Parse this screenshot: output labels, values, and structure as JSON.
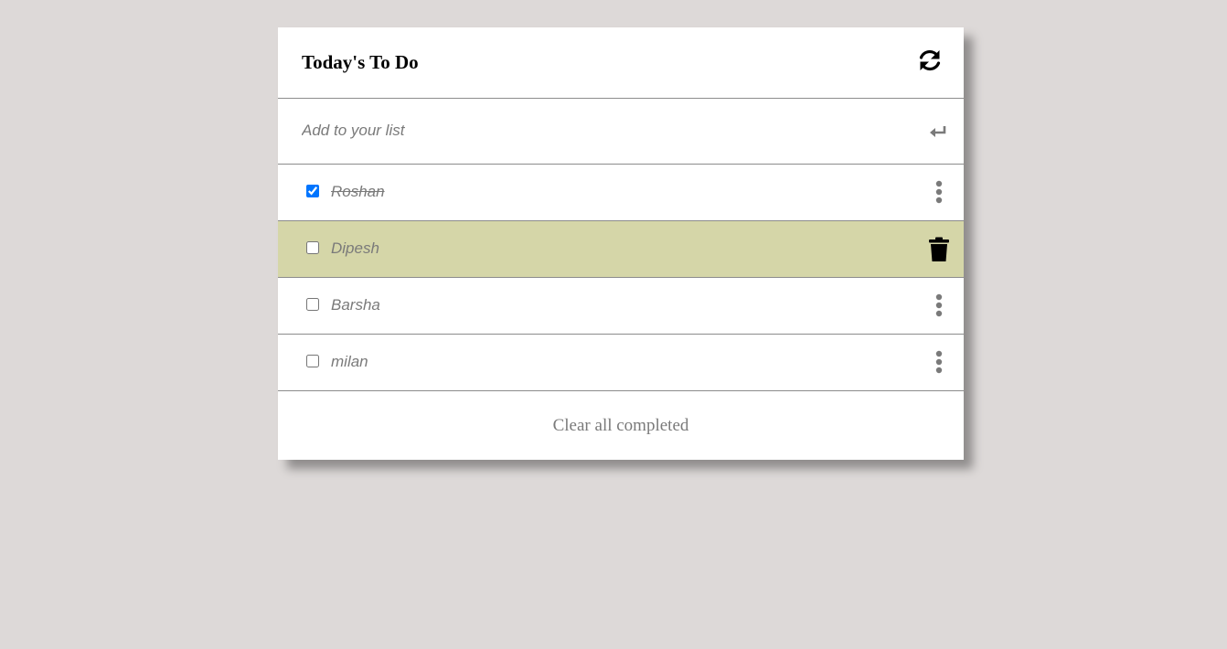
{
  "header": {
    "title": "Today's To Do",
    "refresh_icon": "refresh-icon"
  },
  "add": {
    "placeholder": "Add to your list",
    "value": "",
    "enter_icon": "enter-icon"
  },
  "items": [
    {
      "label": "Roshan",
      "checked": true,
      "hovered": false,
      "action_icon": "more-vertical-icon"
    },
    {
      "label": "Dipesh",
      "checked": false,
      "hovered": true,
      "action_icon": "trash-icon"
    },
    {
      "label": "Barsha",
      "checked": false,
      "hovered": false,
      "action_icon": "more-vertical-icon"
    },
    {
      "label": "milan",
      "checked": false,
      "hovered": false,
      "action_icon": "more-vertical-icon"
    }
  ],
  "footer": {
    "clear_label": "Clear all completed"
  },
  "colors": {
    "background": "#ddd9d8",
    "card": "#ffffff",
    "hover_row": "#d5d6a8",
    "divider": "#8c8c8c",
    "muted_text": "#7a7a7a",
    "checkbox_accent": "#0075ff"
  }
}
